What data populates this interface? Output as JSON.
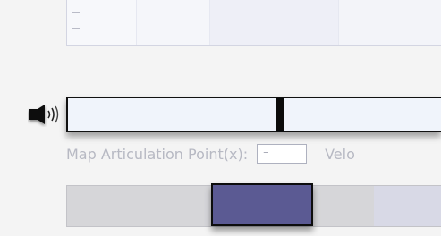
{
  "top_panel": {
    "cells": 5,
    "dash_top": "–",
    "dash_bottom": "–"
  },
  "speaker_icon": "speaker-with-sound-waves-icon",
  "slider": {
    "value_fraction": 0.57
  },
  "map_articulation": {
    "label": "Map Articulation Point(x):",
    "value": "–",
    "trailing_label": "Velo"
  },
  "bottom_bar": {
    "selected_segment": 2,
    "segment_count": 5
  },
  "colors": {
    "background": "#f4f4f4",
    "track": "#f0f4fb",
    "thumb": "#0b0b0b",
    "selected_block": "#5b5a93",
    "bar_gray": "#d6d6d9",
    "label_gray": "#b7b9c3"
  }
}
